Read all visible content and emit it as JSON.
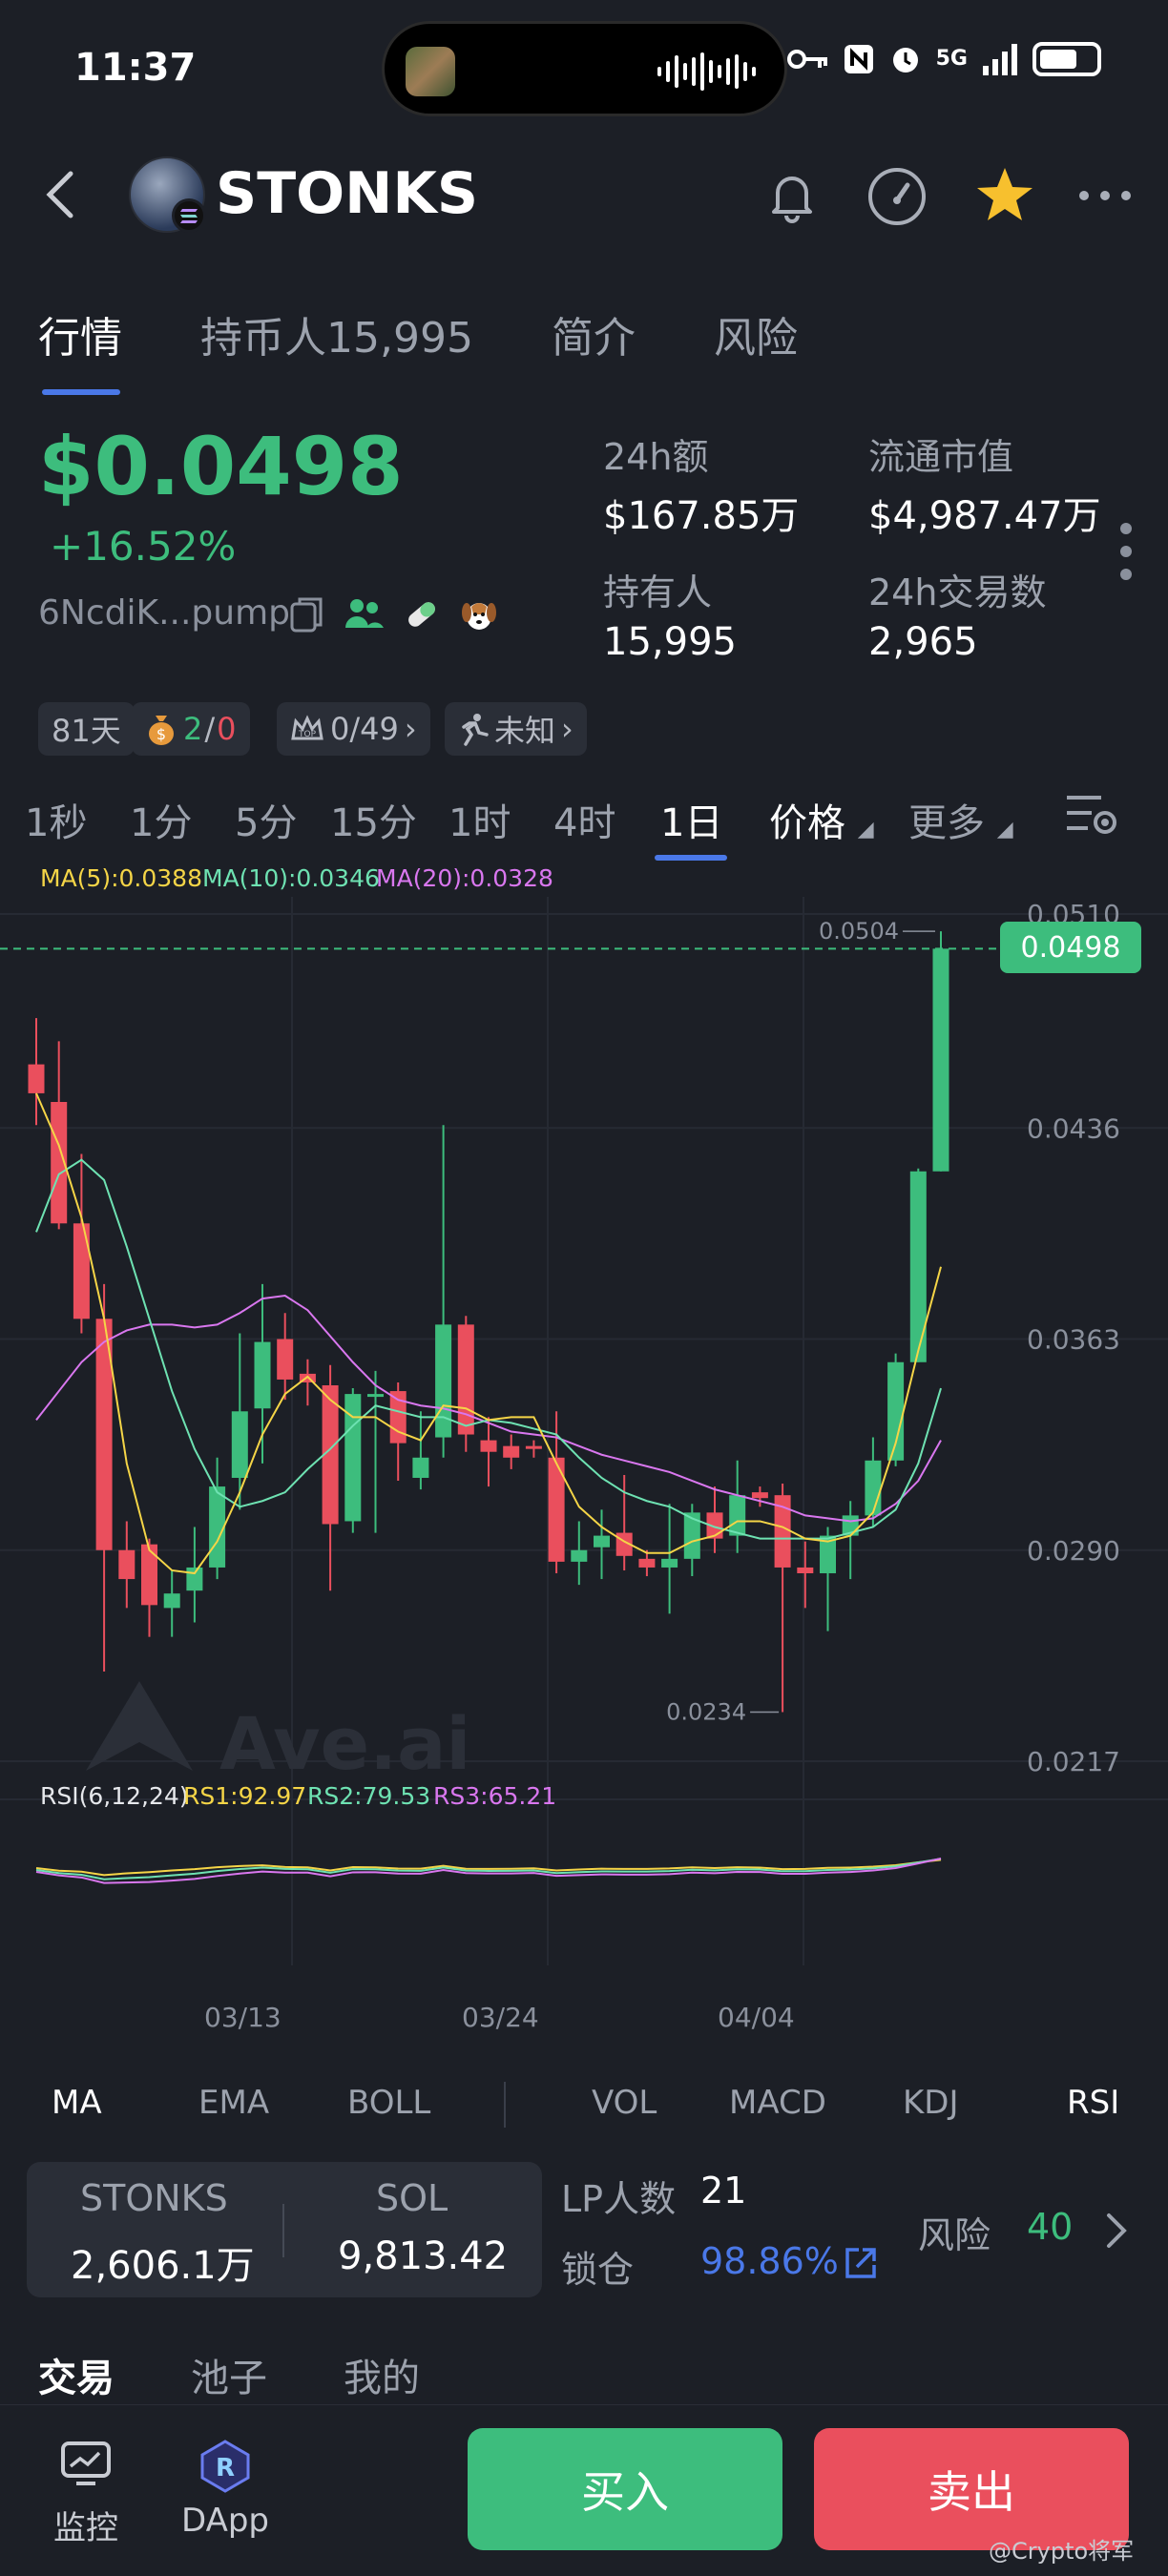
{
  "status_bar": {
    "time": "11:37",
    "network": "5G"
  },
  "header": {
    "title": "STONKS"
  },
  "tabs": [
    {
      "label": "行情",
      "active": true
    },
    {
      "label": "持币人15,995",
      "active": false
    },
    {
      "label": "简介",
      "active": false
    },
    {
      "label": "风险",
      "active": false
    }
  ],
  "price": {
    "value": "$0.0498",
    "change": "+16.52%",
    "address": "6NcdiK...pump"
  },
  "stats": {
    "vol_label": "24h额",
    "vol_value": "$167.85万",
    "mcap_label": "流通市值",
    "mcap_value": "$4,987.47万",
    "holders_label": "持有人",
    "holders_value": "15,995",
    "tx_label": "24h交易数",
    "tx_value": "2,965"
  },
  "chips": {
    "age": "81天",
    "bag_a": "2",
    "bag_sep": "/",
    "bag_b": "0",
    "top": "0/49",
    "runner": "未知"
  },
  "intervals": [
    {
      "label": "1秒"
    },
    {
      "label": "1分"
    },
    {
      "label": "5分"
    },
    {
      "label": "15分"
    },
    {
      "label": "1时"
    },
    {
      "label": "4时"
    },
    {
      "label": "1日",
      "active": true
    }
  ],
  "interval_extra": {
    "price": "价格",
    "more": "更多"
  },
  "ma_legend": {
    "ma5": "MA(5):0.0388",
    "ma10": "MA(10):0.0346",
    "ma20": "MA(20):0.0328"
  },
  "rsi_legend": {
    "label": "RSI(6,12,24)",
    "rsi1": "RS1:92.97",
    "rsi2": "RS2:79.53",
    "rsi3": "RS3:65.21"
  },
  "watermark": "Ave.ai",
  "current_price_tag": "0.0498",
  "high_label": "0.0504",
  "low_label": "0.0234",
  "colors": {
    "up": "#3dbd7d",
    "down": "#ea4f5d",
    "accent": "#4a78e8",
    "ma5": "#f5d547",
    "ma10": "#6ee2b2",
    "ma20": "#d977ef"
  },
  "chart_data": {
    "type": "candlestick",
    "y_ticks": [
      "0.0510",
      "0.0436",
      "0.0363",
      "0.0290",
      "0.0217"
    ],
    "x_ticks": [
      "03/13",
      "03/24",
      "04/04"
    ],
    "ylim": [
      0.0217,
      0.051
    ],
    "candles": [
      {
        "o": 0.0458,
        "c": 0.0448,
        "h": 0.0474,
        "l": 0.0437
      },
      {
        "o": 0.0445,
        "c": 0.0403,
        "h": 0.0466,
        "l": 0.0401
      },
      {
        "o": 0.0403,
        "c": 0.037,
        "h": 0.0427,
        "l": 0.0365
      },
      {
        "o": 0.037,
        "c": 0.029,
        "h": 0.0382,
        "l": 0.0248
      },
      {
        "o": 0.029,
        "c": 0.028,
        "h": 0.03,
        "l": 0.027
      },
      {
        "o": 0.0292,
        "c": 0.0271,
        "h": 0.0294,
        "l": 0.026
      },
      {
        "o": 0.027,
        "c": 0.0275,
        "h": 0.0283,
        "l": 0.026
      },
      {
        "o": 0.0276,
        "c": 0.0284,
        "h": 0.0298,
        "l": 0.0265
      },
      {
        "o": 0.0284,
        "c": 0.0312,
        "h": 0.0322,
        "l": 0.028
      },
      {
        "o": 0.0315,
        "c": 0.0338,
        "h": 0.0365,
        "l": 0.0304
      },
      {
        "o": 0.0339,
        "c": 0.0362,
        "h": 0.0382,
        "l": 0.032
      },
      {
        "o": 0.0363,
        "c": 0.0349,
        "h": 0.0372,
        "l": 0.0342
      },
      {
        "o": 0.0351,
        "c": 0.0348,
        "h": 0.0356,
        "l": 0.034
      },
      {
        "o": 0.0347,
        "c": 0.0299,
        "h": 0.0354,
        "l": 0.0276
      },
      {
        "o": 0.03,
        "c": 0.0344,
        "h": 0.0346,
        "l": 0.0296
      },
      {
        "o": 0.0344,
        "c": 0.0344,
        "h": 0.0352,
        "l": 0.0296
      },
      {
        "o": 0.0345,
        "c": 0.0327,
        "h": 0.0348,
        "l": 0.0314
      },
      {
        "o": 0.0315,
        "c": 0.0322,
        "h": 0.0338,
        "l": 0.0311
      },
      {
        "o": 0.0329,
        "c": 0.0368,
        "h": 0.0437,
        "l": 0.0322
      },
      {
        "o": 0.0368,
        "c": 0.033,
        "h": 0.0371,
        "l": 0.0324
      },
      {
        "o": 0.0328,
        "c": 0.0324,
        "h": 0.0336,
        "l": 0.0312
      },
      {
        "o": 0.0326,
        "c": 0.0322,
        "h": 0.033,
        "l": 0.0318
      },
      {
        "o": 0.0326,
        "c": 0.0325,
        "h": 0.0328,
        "l": 0.0322
      },
      {
        "o": 0.0322,
        "c": 0.0286,
        "h": 0.0338,
        "l": 0.0282
      },
      {
        "o": 0.0286,
        "c": 0.029,
        "h": 0.03,
        "l": 0.0278
      },
      {
        "o": 0.0291,
        "c": 0.0295,
        "h": 0.0304,
        "l": 0.028
      },
      {
        "o": 0.0296,
        "c": 0.0288,
        "h": 0.0316,
        "l": 0.0283
      },
      {
        "o": 0.0287,
        "c": 0.0284,
        "h": 0.029,
        "l": 0.0281
      },
      {
        "o": 0.0284,
        "c": 0.0287,
        "h": 0.0306,
        "l": 0.0268
      },
      {
        "o": 0.0287,
        "c": 0.0303,
        "h": 0.0306,
        "l": 0.0281
      },
      {
        "o": 0.0303,
        "c": 0.0294,
        "h": 0.0312,
        "l": 0.0289
      },
      {
        "o": 0.0295,
        "c": 0.0309,
        "h": 0.0321,
        "l": 0.0289
      },
      {
        "o": 0.031,
        "c": 0.0308,
        "h": 0.0312,
        "l": 0.0305
      },
      {
        "o": 0.0309,
        "c": 0.0284,
        "h": 0.0313,
        "l": 0.0234
      },
      {
        "o": 0.0284,
        "c": 0.0282,
        "h": 0.0293,
        "l": 0.027
      },
      {
        "o": 0.0282,
        "c": 0.0295,
        "h": 0.0298,
        "l": 0.0262
      },
      {
        "o": 0.0295,
        "c": 0.0302,
        "h": 0.0307,
        "l": 0.028
      },
      {
        "o": 0.0302,
        "c": 0.0321,
        "h": 0.0329,
        "l": 0.0298
      },
      {
        "o": 0.0321,
        "c": 0.0355,
        "h": 0.0358,
        "l": 0.0319
      },
      {
        "o": 0.0355,
        "c": 0.0421,
        "h": 0.0422,
        "l": 0.0355
      },
      {
        "o": 0.0421,
        "c": 0.0498,
        "h": 0.0504,
        "l": 0.0421
      }
    ],
    "ma5": [
      0.0448,
      0.043,
      0.0405,
      0.037,
      0.032,
      0.029,
      0.0283,
      0.0282,
      0.0293,
      0.031,
      0.033,
      0.0344,
      0.035,
      0.0342,
      0.0336,
      0.0336,
      0.0331,
      0.0328,
      0.034,
      0.0339,
      0.0335,
      0.0336,
      0.0336,
      0.032,
      0.0305,
      0.0298,
      0.0293,
      0.0289,
      0.0289,
      0.0293,
      0.0295,
      0.03,
      0.03,
      0.0298,
      0.0294,
      0.0293,
      0.0295,
      0.0303,
      0.0327,
      0.0359,
      0.0388
    ],
    "ma10": [
      0.04,
      0.042,
      0.0425,
      0.0418,
      0.0395,
      0.037,
      0.0345,
      0.0325,
      0.031,
      0.0305,
      0.0307,
      0.031,
      0.0318,
      0.0325,
      0.0333,
      0.034,
      0.0338,
      0.0336,
      0.0336,
      0.0333,
      0.0335,
      0.0334,
      0.0332,
      0.033,
      0.0322,
      0.0315,
      0.031,
      0.0307,
      0.0305,
      0.0301,
      0.0298,
      0.0296,
      0.0294,
      0.0294,
      0.0294,
      0.0294,
      0.0296,
      0.0298,
      0.0304,
      0.032,
      0.0346
    ],
    "ma20": [
      0.0335,
      0.0345,
      0.0355,
      0.0362,
      0.0366,
      0.0368,
      0.0368,
      0.0367,
      0.0368,
      0.0372,
      0.0377,
      0.0378,
      0.0373,
      0.0364,
      0.0355,
      0.0347,
      0.0342,
      0.034,
      0.0339,
      0.0337,
      0.0334,
      0.0331,
      0.033,
      0.0329,
      0.0326,
      0.0323,
      0.0321,
      0.0319,
      0.0317,
      0.0314,
      0.0311,
      0.0309,
      0.0307,
      0.0305,
      0.0302,
      0.0301,
      0.03,
      0.0301,
      0.0306,
      0.0314,
      0.0328
    ]
  },
  "indicators": {
    "main": [
      {
        "label": "MA",
        "active": true
      },
      {
        "label": "EMA"
      },
      {
        "label": "BOLL"
      }
    ],
    "sub": [
      {
        "label": "VOL"
      },
      {
        "label": "MACD"
      },
      {
        "label": "KDJ"
      },
      {
        "label": "RSI",
        "active": true
      }
    ]
  },
  "liquidity": {
    "token_a": "STONKS",
    "amount_a": "2,606.1万",
    "token_b": "SOL",
    "amount_b": "9,813.42"
  },
  "lp": {
    "count_label": "LP人数",
    "count_value": "21",
    "lock_label": "锁仓",
    "lock_value": "98.86%",
    "risk_label": "风险",
    "risk_value": "40"
  },
  "bottom_tabs": [
    {
      "label": "交易",
      "active": true
    },
    {
      "label": "池子"
    },
    {
      "label": "我的"
    }
  ],
  "nav": {
    "monitor": "监控",
    "dapp": "DApp",
    "buy": "买入",
    "sell": "卖出",
    "credit": "@Crypto将军"
  }
}
